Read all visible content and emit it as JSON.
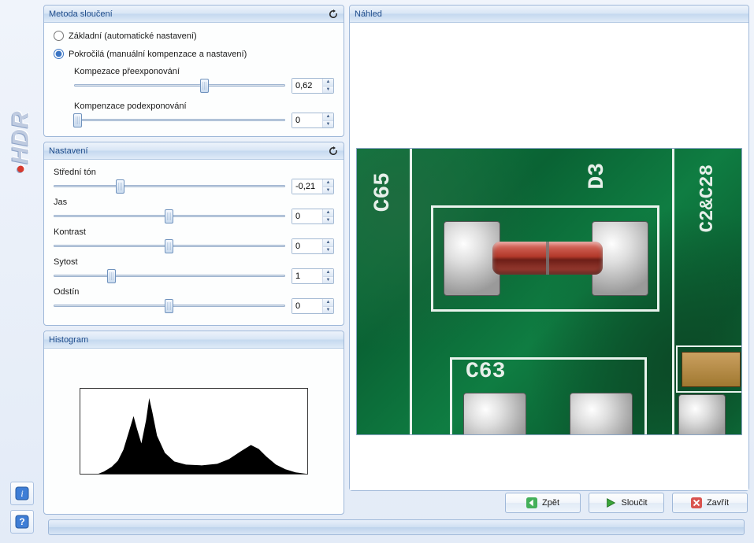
{
  "sidebar": {
    "logo_text": "HDR",
    "info_icon": "info-icon",
    "help_icon": "help-icon"
  },
  "panels": {
    "method": {
      "title": "Metoda sloučení",
      "basic_label": "Základní (automatické nastavení)",
      "advanced_label": "Pokročilá (manuální kompenzace a nastavení)",
      "mode_selected": "advanced",
      "overexp": {
        "label": "Kompezace přeexponování",
        "value": "0,62",
        "pos_pct": 62
      },
      "underexp": {
        "label": "Kompenzace podexponování",
        "value": "0",
        "pos_pct": 2
      }
    },
    "settings": {
      "title": "Nastavení",
      "items": [
        {
          "key": "midtone",
          "label": "Střední tón",
          "value": "-0,21",
          "pos_pct": 29
        },
        {
          "key": "brightness",
          "label": "Jas",
          "value": "0",
          "pos_pct": 50
        },
        {
          "key": "contrast",
          "label": "Kontrast",
          "value": "0",
          "pos_pct": 50
        },
        {
          "key": "saturation",
          "label": "Sytost",
          "value": "1",
          "pos_pct": 25
        },
        {
          "key": "hue",
          "label": "Odstín",
          "value": "0",
          "pos_pct": 50
        }
      ]
    },
    "histogram": {
      "title": "Histogram"
    },
    "preview": {
      "title": "Náhled",
      "labels": {
        "c65": "C65",
        "d3": "D3",
        "c24c28": "C2&C28",
        "c63": "C63"
      }
    }
  },
  "buttons": {
    "back": "Zpět",
    "merge": "Sloučit",
    "close": "Zavřít"
  }
}
